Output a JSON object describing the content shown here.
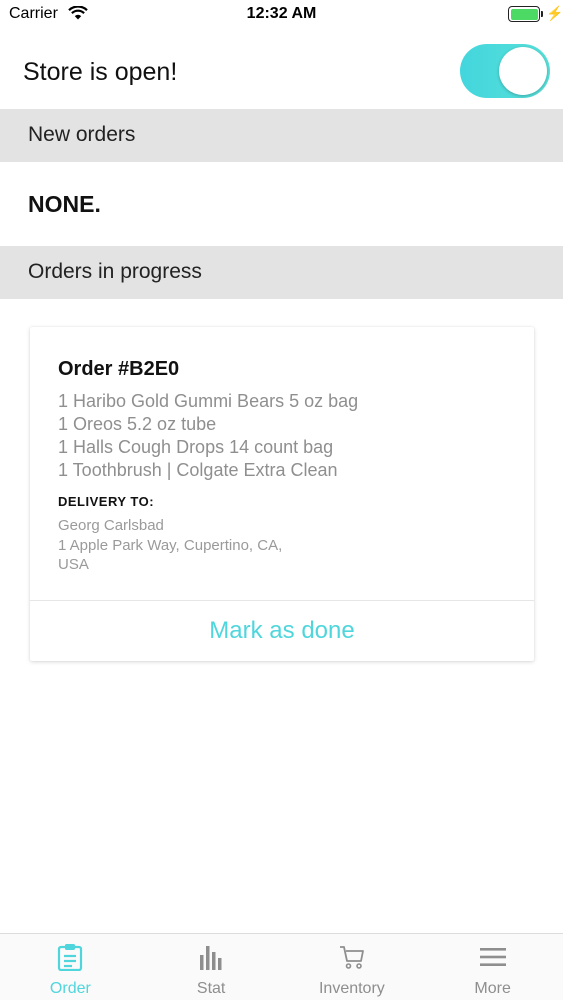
{
  "status_bar": {
    "carrier": "Carrier",
    "time": "12:32 AM"
  },
  "store": {
    "label": "Store is open!",
    "toggle_on": true
  },
  "sections": {
    "new_orders": "New orders",
    "new_orders_empty": "NONE.",
    "in_progress": "Orders in progress"
  },
  "order": {
    "title": "Order #B2E0",
    "items": [
      "1 Haribo Gold Gummi Bears 5 oz bag",
      "1 Oreos 5.2 oz tube",
      "1 Halls Cough Drops 14 count bag",
      "1 Toothbrush | Colgate Extra Clean"
    ],
    "delivery_label": "DELIVERY TO:",
    "recipient": "Georg Carlsbad",
    "address_line1": "1 Apple Park Way, Cupertino, CA,",
    "address_line2": "USA",
    "action": "Mark as done"
  },
  "tabs": [
    {
      "label": "Order",
      "icon": "clipboard-icon",
      "active": true
    },
    {
      "label": "Stat",
      "icon": "bar-chart-icon",
      "active": false
    },
    {
      "label": "Inventory",
      "icon": "cart-icon",
      "active": false
    },
    {
      "label": "More",
      "icon": "menu-icon",
      "active": false
    }
  ],
  "colors": {
    "accent": "#4fd6dc",
    "section_bg": "#e3e3e3",
    "muted_text": "#8f8f8f"
  }
}
